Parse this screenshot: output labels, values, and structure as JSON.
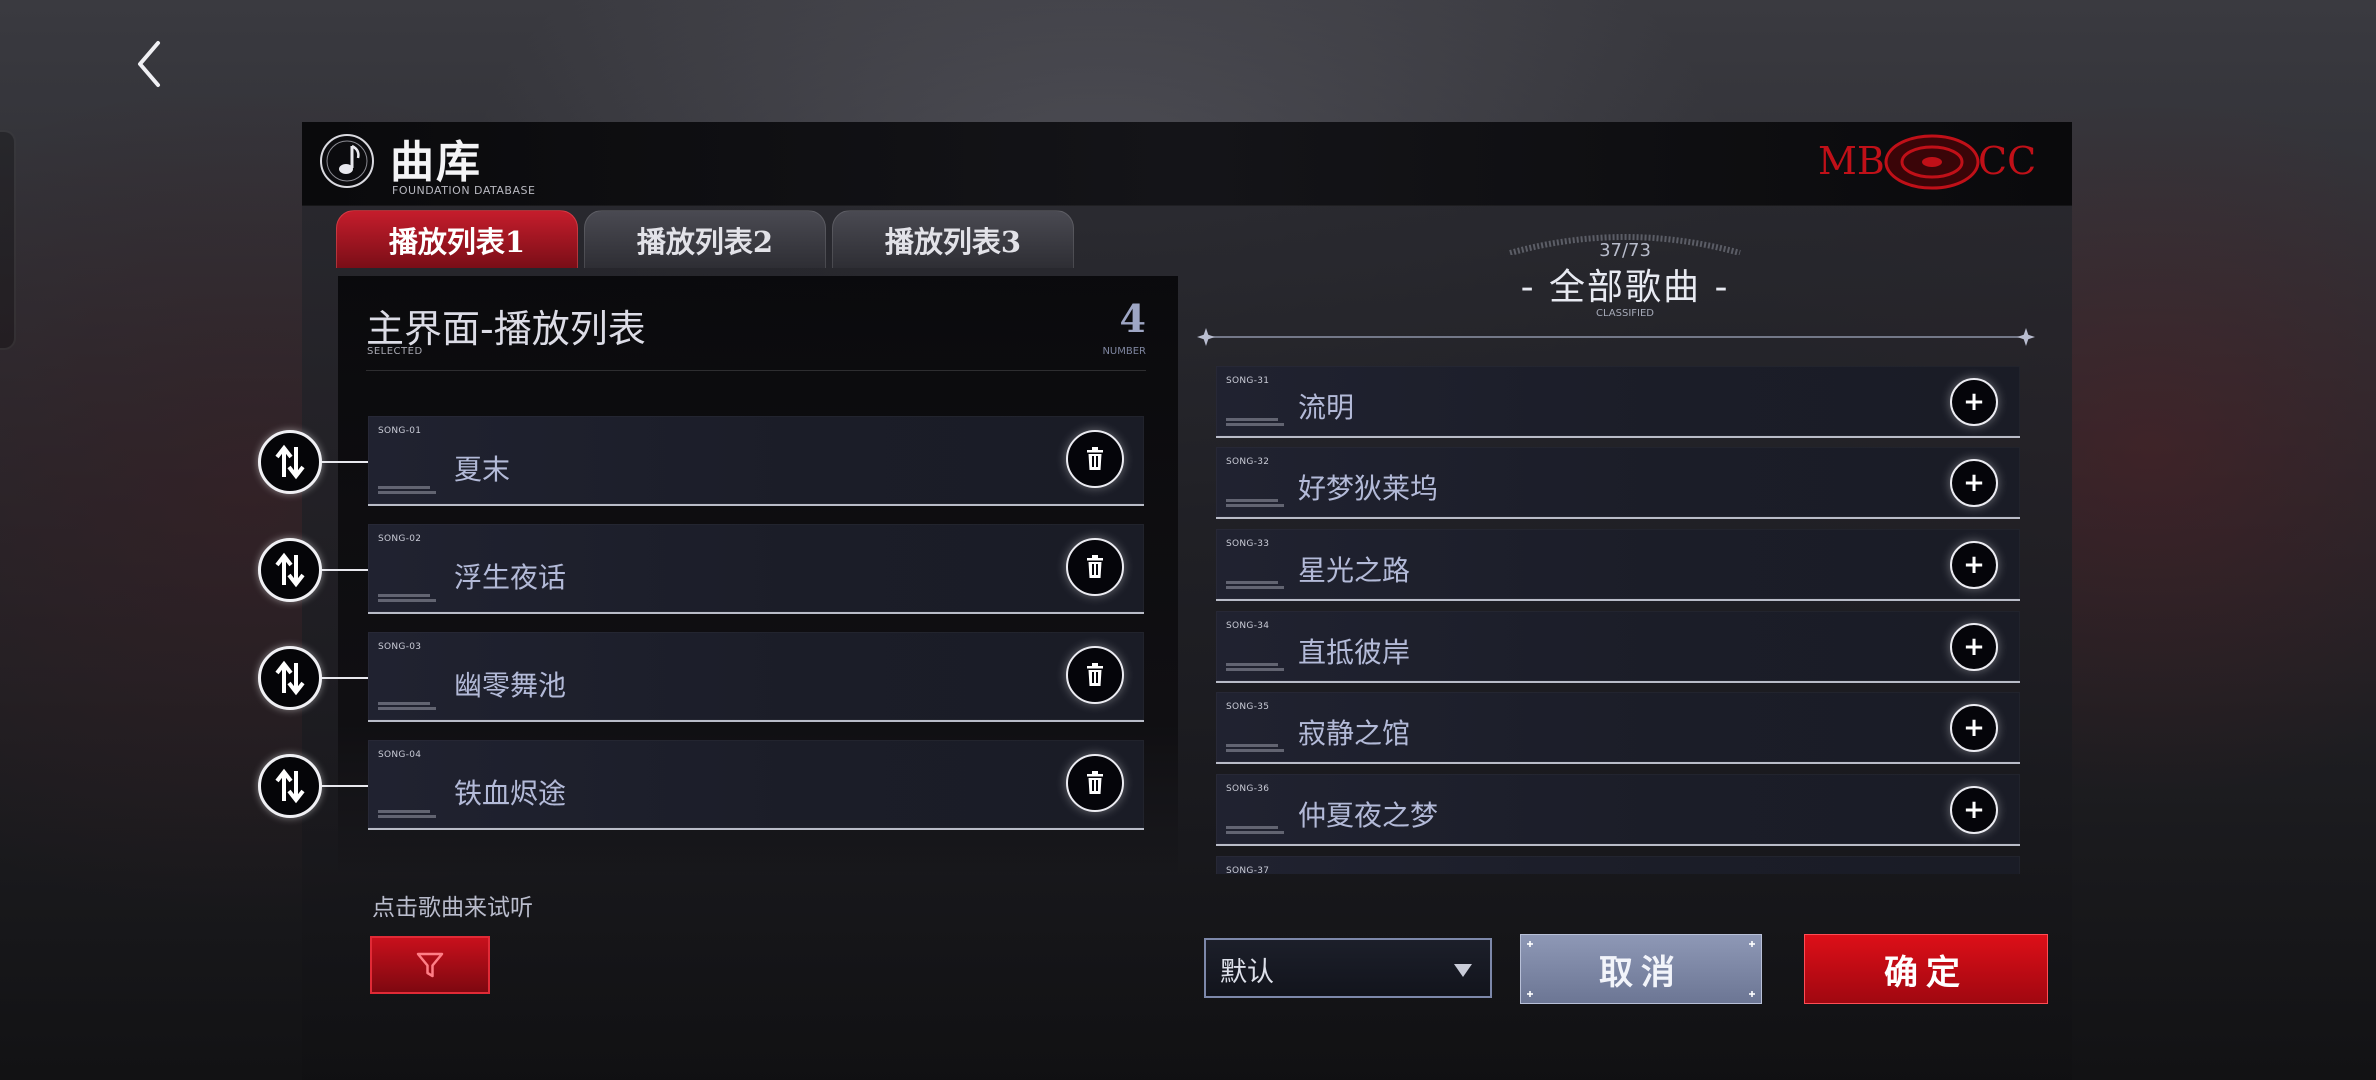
{
  "header": {
    "title": "曲库",
    "subtitle": "FOUNDATION DATABASE",
    "brand_left": "MB",
    "brand_right": "CC"
  },
  "tabs": [
    {
      "label": "播放列表1",
      "active": true
    },
    {
      "label": "播放列表2",
      "active": false
    },
    {
      "label": "播放列表3",
      "active": false
    }
  ],
  "playlist": {
    "title": "主界面-播放列表",
    "selected_label": "SELECTED",
    "count": "4",
    "count_label": "NUMBER",
    "hint": "点击歌曲来试听",
    "songs": [
      {
        "code": "SONG-01",
        "name": "夏末"
      },
      {
        "code": "SONG-02",
        "name": "浮生夜话"
      },
      {
        "code": "SONG-03",
        "name": "幽零舞池"
      },
      {
        "code": "SONG-04",
        "name": "铁血烬途"
      }
    ]
  },
  "catalog": {
    "count": "37/73",
    "title": "- 全部歌曲 -",
    "subtitle": "CLASSIFIED",
    "songs": [
      {
        "code": "SONG-31",
        "name": "流明"
      },
      {
        "code": "SONG-32",
        "name": "好梦狄莱坞"
      },
      {
        "code": "SONG-33",
        "name": "星光之路"
      },
      {
        "code": "SONG-34",
        "name": "直抵彼岸"
      },
      {
        "code": "SONG-35",
        "name": "寂静之馆"
      },
      {
        "code": "SONG-36",
        "name": "仲夏夜之梦"
      },
      {
        "code": "SONG-37",
        "name": ""
      }
    ]
  },
  "controls": {
    "sort_value": "默认",
    "cancel_label": "取消",
    "confirm_label": "确定"
  },
  "colors": {
    "accent_red": "#c8101c",
    "cancel_blue_grey": "#7c86a4",
    "row_bg": "#1d1f2b"
  }
}
